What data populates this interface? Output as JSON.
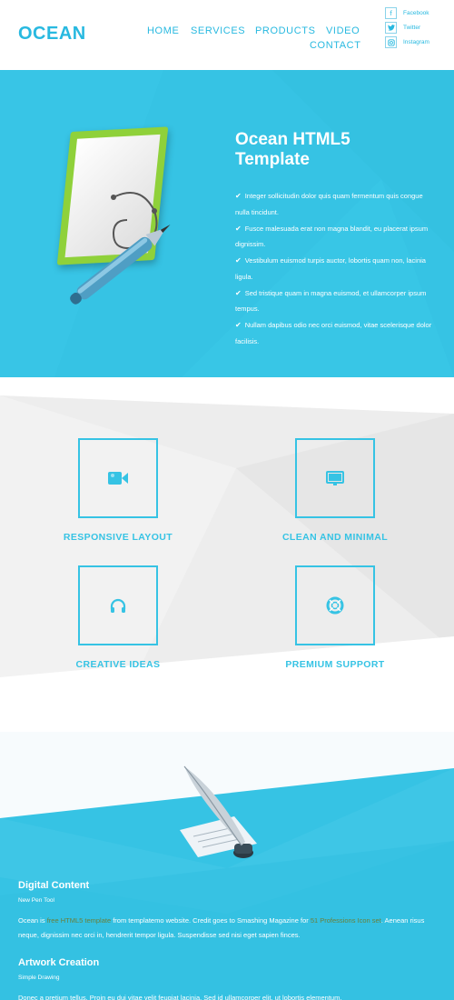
{
  "header": {
    "logo": "OCEAN",
    "nav": [
      "HOME",
      "SERVICES",
      "PRODUCTS",
      "VIDEO",
      "CONTACT"
    ],
    "social": [
      {
        "icon": "facebook-icon",
        "glyph": "f",
        "label": "Facebook"
      },
      {
        "icon": "twitter-icon",
        "glyph": "t",
        "label": "Twitter"
      },
      {
        "icon": "instagram-icon",
        "glyph": "◎",
        "label": "Instagram"
      }
    ]
  },
  "hero": {
    "title_line1": "Ocean HTML5",
    "title_line2": "Template",
    "items": [
      "Integer sollicitudin dolor quis quam fermentum quis congue nulla tincidunt.",
      "Fusce malesuada erat non magna blandit, eu placerat ipsum dignissim.",
      "Vestibulum euismod turpis auctor, lobortis quam non, lacinia ligula.",
      "Sed tristique quam in magna euismod, et ullamcorper ipsum tempus.",
      "Nullam dapibus odio nec orci euismod, vitae scelerisque dolor facilisis."
    ]
  },
  "features": [
    {
      "label": "RESPONSIVE LAYOUT",
      "icon": "video-camera-icon"
    },
    {
      "label": "CLEAN AND MINIMAL",
      "icon": "monitor-icon"
    },
    {
      "label": "CREATIVE IDEAS",
      "icon": "headphones-icon"
    },
    {
      "label": "PREMIUM SUPPORT",
      "icon": "lifebuoy-icon"
    }
  ],
  "content": [
    {
      "title": "Digital Content",
      "subtitle": "New Pen Tool",
      "body_pre": "Ocean is ",
      "body_link1": "free HTML5 template",
      "body_mid": " from templatemo website. Credit goes to Smashing Magazine for ",
      "body_link2": "51 Professions Icon set",
      "body_post": ". Aenean risus neque, dignissim nec orci in, hendrerit tempor ligula. Suspendisse sed nisi eget sapien finces."
    },
    {
      "title": "Artwork Creation",
      "subtitle": "Simple Drawing",
      "body": "Donec a pretium tellus. Proin eu dui vitae velit feugiat lacinia. Sed id ullamcorper elit, ut lobortis elementum."
    }
  ],
  "colors": {
    "brand": "#28b9e0",
    "hero_bg": "#36c3e4",
    "feature_bg": "#ededed"
  }
}
